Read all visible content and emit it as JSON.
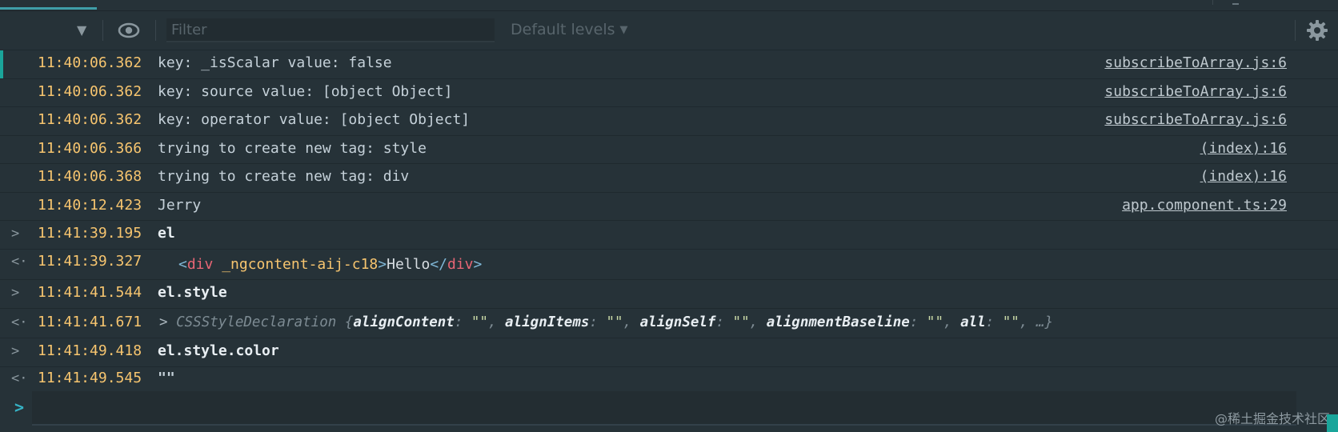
{
  "toolbar": {
    "context_arrow": "▼",
    "filter_placeholder": "Filter",
    "levels_label": "Default levels",
    "levels_caret": "▼"
  },
  "logs": [
    {
      "marker": "",
      "timestamp": "11:40:06.362",
      "message": "key: _isScalar value: false",
      "source": "subscribeToArray.js:6"
    },
    {
      "marker": "",
      "timestamp": "11:40:06.362",
      "message": "key: source value: [object Object]",
      "source": "subscribeToArray.js:6"
    },
    {
      "marker": "",
      "timestamp": "11:40:06.362",
      "message": "key: operator value: [object Object]",
      "source": "subscribeToArray.js:6"
    },
    {
      "marker": "",
      "timestamp": "11:40:06.366",
      "message": "trying to create new tag: style",
      "source": "(index):16"
    },
    {
      "marker": "",
      "timestamp": "11:40:06.368",
      "message": "trying to create new tag: div",
      "source": "(index):16"
    },
    {
      "marker": "",
      "timestamp": "11:40:12.423",
      "message": "Jerry",
      "source": "app.component.ts:29"
    },
    {
      "marker": ">",
      "timestamp": "11:41:39.195",
      "message": "el"
    },
    {
      "marker": "<·",
      "timestamp": "11:41:39.327",
      "element": {
        "open": "<",
        "tag": "div",
        "attr": "_ngcontent-aij-c18",
        "close": ">",
        "text": "Hello",
        "end_open": "</",
        "end_tag": "div",
        "end_close": ">"
      }
    },
    {
      "marker": ">",
      "timestamp": "11:41:41.544",
      "message": "el.style"
    },
    {
      "marker": "<·",
      "timestamp": "11:41:41.671",
      "object": {
        "expander": ">",
        "name": "CSSStyleDeclaration",
        "brace_open": "{",
        "entries": [
          {
            "key": "alignContent",
            "value": "\"\""
          },
          {
            "key": "alignItems",
            "value": "\"\""
          },
          {
            "key": "alignSelf",
            "value": "\"\""
          },
          {
            "key": "alignmentBaseline",
            "value": "\"\""
          },
          {
            "key": "all",
            "value": "\"\""
          }
        ],
        "ellipsis": "…}"
      }
    },
    {
      "marker": ">",
      "timestamp": "11:41:49.418",
      "message": "el.style.color"
    },
    {
      "marker": "<·",
      "timestamp": "11:41:49.545",
      "result": "\"\""
    }
  ],
  "prompt": {
    "marker": ">"
  },
  "watermark": "@稀土掘金技术社区",
  "colors": {
    "background": "#263238",
    "timestamp": "#f7c56f",
    "accent": "#1aa59a",
    "tag_name": "#e86675"
  }
}
